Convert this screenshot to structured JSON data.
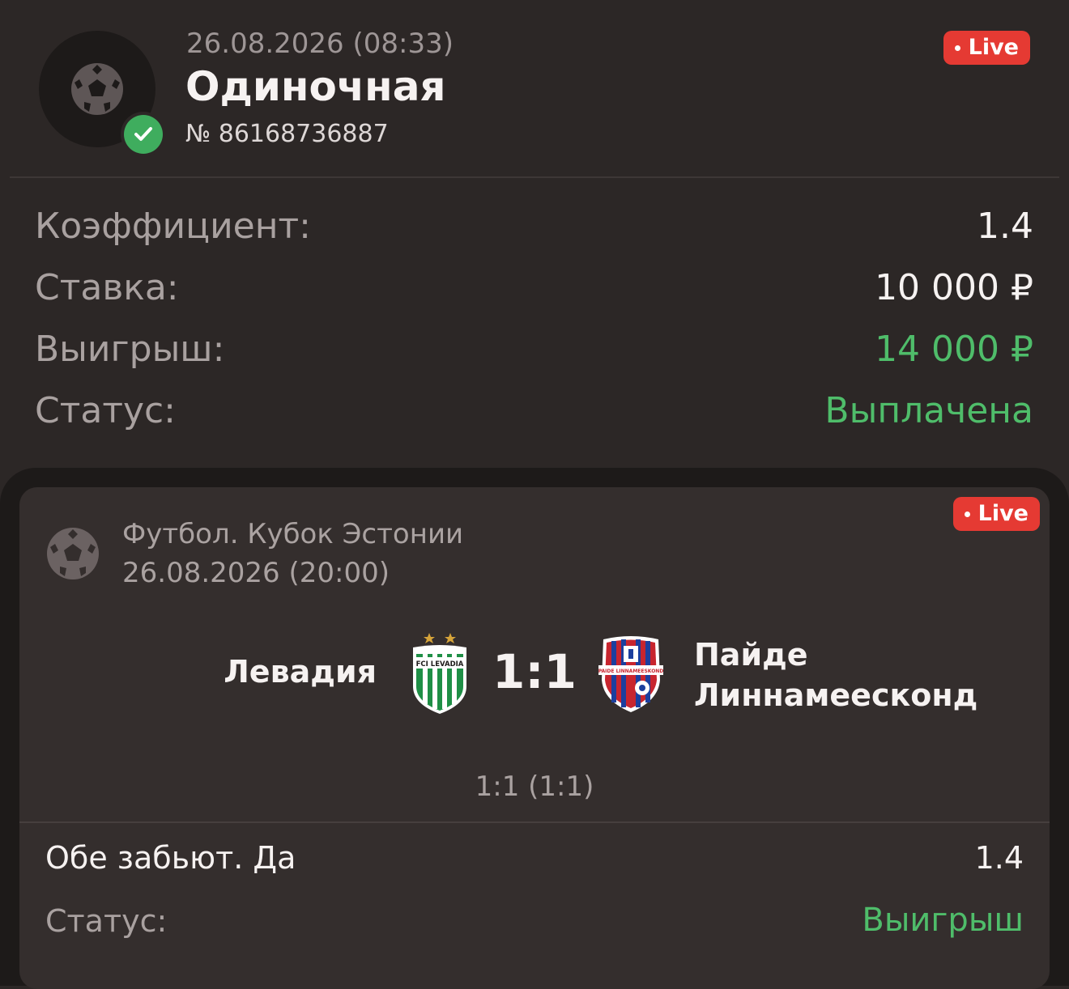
{
  "header": {
    "datetime": "26.08.2026 (08:33)",
    "bet_type": "Одиночная",
    "bet_number": "№ 86168736887",
    "live_label": "Live"
  },
  "summary": {
    "odds_label": "Коэффициент:",
    "odds_value": "1.4",
    "stake_label": "Ставка:",
    "stake_value": "10 000 ₽",
    "win_label": "Выигрыш:",
    "win_value": "14 000 ₽",
    "status_label": "Статус:",
    "status_value": "Выплачена"
  },
  "event": {
    "live_label": "Live",
    "league": "Футбол. Кубок Эстонии",
    "datetime": "26.08.2026 (20:00)",
    "home_team": "Левадия",
    "home_logo_text": "FCI LEVADIA",
    "score": "1:1",
    "away_team_line1": "Пайде",
    "away_team_line2": "Линнамеесконд",
    "away_logo_text": "PAIDE LINNAMEESKOND",
    "score_detail": "1:1 (1:1)",
    "bet_name": "Обе забьют. Да",
    "bet_odds": "1.4",
    "status_label": "Статус:",
    "status_value": "Выигрыш"
  },
  "colors": {
    "background": "#2c2726",
    "card": "#342e2d",
    "live_badge": "#e53a33",
    "success_green": "#4fbd6a",
    "muted_text": "#a9a1a0"
  },
  "icons": {
    "sport": "football-icon",
    "status": "checkmark-icon"
  }
}
